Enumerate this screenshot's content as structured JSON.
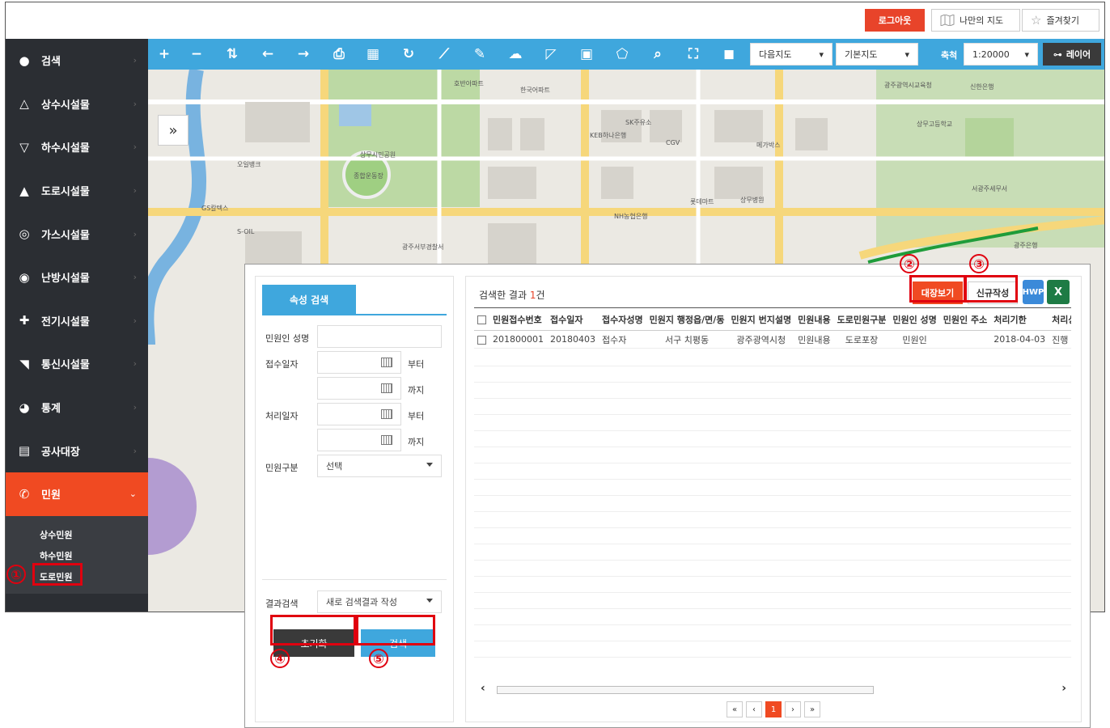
{
  "topbar": {
    "logout": "로그아웃",
    "my_map": "나만의 지도",
    "favorites": "즐겨찾기"
  },
  "sidebar": {
    "items": [
      {
        "label": "검색",
        "icon": "location-pin-icon"
      },
      {
        "label": "상수시설물",
        "icon": "triangle-up-icon"
      },
      {
        "label": "하수시설물",
        "icon": "triangle-down-icon"
      },
      {
        "label": "도로시설물",
        "icon": "road-icon"
      },
      {
        "label": "가스시설물",
        "icon": "gas-icon"
      },
      {
        "label": "난방시설물",
        "icon": "heating-icon"
      },
      {
        "label": "전기시설물",
        "icon": "plug-icon"
      },
      {
        "label": "통신시설물",
        "icon": "signal-icon"
      },
      {
        "label": "통계",
        "icon": "pie-chart-icon"
      },
      {
        "label": "공사대장",
        "icon": "document-search-icon"
      },
      {
        "label": "민원",
        "icon": "phone-icon"
      }
    ],
    "submenu": [
      "상수민원",
      "하수민원",
      "도로민원"
    ]
  },
  "toolbar": {
    "map_source": "다음지도",
    "base_map": "기본지도",
    "scale_label": "축척",
    "scale_value": "1:20000",
    "layer": "레이어"
  },
  "map": {
    "expand": "»",
    "labels": [
      "상무시민공원",
      "KEB하나은행",
      "CGV",
      "메가박스",
      "SK주유소",
      "광주서부경찰서",
      "신한은행",
      "상무병원",
      "롯데마트",
      "호반아파트",
      "한국어파트",
      "NH농협은행",
      "서광주세무서",
      "오일뱅크",
      "GS칼텍스",
      "S-OIL",
      "광주은행",
      "상무고등학교",
      "광주광역시교육청",
      "종합운동장"
    ]
  },
  "panel": {
    "tab": "속성 검색",
    "fields": {
      "applicant_name": "민원인 성명",
      "receipt_date": "접수일자",
      "process_date": "처리일자",
      "complaint_type": "민원구분",
      "complaint_type_value": "선택",
      "result_search": "결과검색",
      "result_search_value": "새로 검색결과 작성",
      "from": "부터",
      "to": "까지"
    },
    "buttons": {
      "reset": "초기화",
      "search": "검색"
    },
    "result": {
      "prefix": "검색한 결과 ",
      "count": "1",
      "suffix": "건",
      "ledger": "대장보기",
      "new": "신규작성",
      "hwp": "HWP",
      "xls": "X"
    },
    "table": {
      "headers": [
        "민원접수번호",
        "접수일자",
        "접수자성명",
        "민원지 행정읍/면/동",
        "민원지 번지설명",
        "민원내용",
        "도로민원구분",
        "민원인 성명",
        "민원인 주소",
        "처리기한",
        "처리상태"
      ],
      "rows": [
        [
          "201800001",
          "20180403",
          "접수자",
          "서구 치평동",
          "광주광역시청",
          "민원내용",
          "도로포장",
          "민원인",
          "",
          "2018-04-03",
          "진행"
        ]
      ]
    },
    "pager": [
      "«",
      "‹",
      "1",
      "›",
      "»"
    ]
  },
  "annotations": [
    "①",
    "②",
    "③",
    "④",
    "⑤"
  ]
}
